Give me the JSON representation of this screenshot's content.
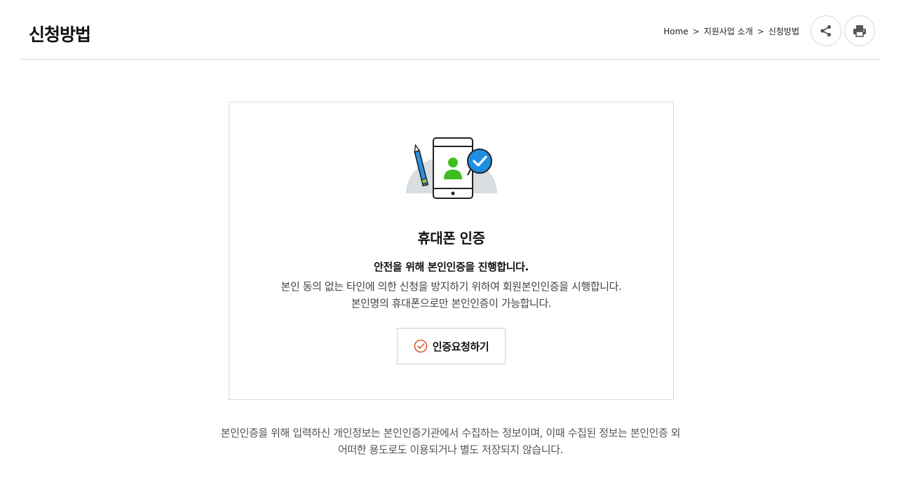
{
  "page": {
    "title": "신청방법"
  },
  "breadcrumb": {
    "items": [
      "Home",
      "지원사업 소개",
      "신청방법"
    ],
    "separator": ">"
  },
  "actions": {
    "share_icon": "share-icon",
    "print_icon": "print-icon"
  },
  "card": {
    "title": "휴대폰 인증",
    "subtitle": "안전을 위해 본인인증을 진행합니다.",
    "desc_line1": "본인 동의 없는 타인에 의한 신청을 방지하기 위하여 회원본인인증을 시행합니다.",
    "desc_line2": "본인명의 휴대폰으로만 본인인증이 가능합니다.",
    "button_label": "인증요청하기",
    "button_icon": "check-circle-icon",
    "illustration_icon": "phone-verification-icon"
  },
  "footer": {
    "line1": "본인인증을 위해 입력하신 개인정보는 본인인증기관에서 수집하는 정보이며, 이때 수집된 정보는 본인인증 외",
    "line2": "어떠한 용도로도 이용되거나 별도 저장되지 않습니다."
  },
  "colors": {
    "accent_check": "#e05a2b",
    "person_green": "#3dbe1f",
    "badge_blue": "#1e8ee0",
    "pen_blue": "#2d8fe0"
  }
}
